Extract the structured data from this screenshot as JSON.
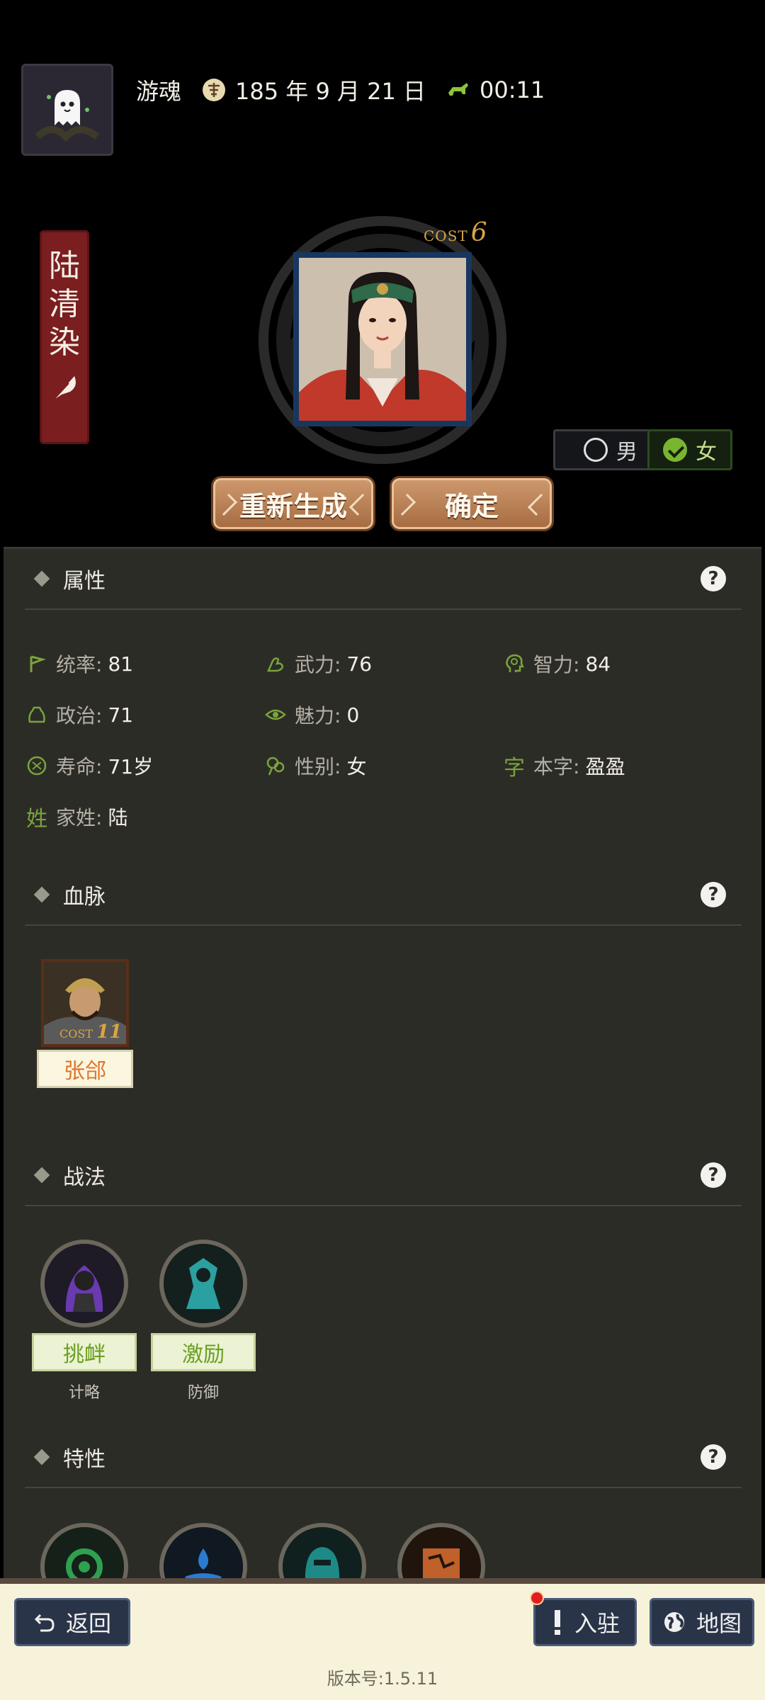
{
  "header": {
    "player_name": "游魂",
    "date": "185 年 9 月 21 日",
    "time": "00:11",
    "avatar_icon": "ghost-avatar-icon",
    "calendar_icon": "calendar-seal-icon",
    "time_icon": "horse-icon"
  },
  "character": {
    "name_chars": [
      "陆",
      "清",
      "染"
    ],
    "cost_label": "COST",
    "cost_value": "6",
    "gender_male": "男",
    "gender_female": "女",
    "selected_gender": "女"
  },
  "actions": {
    "regenerate": "重新生成",
    "confirm": "确定"
  },
  "attributes": {
    "title": "属性",
    "help": "?",
    "items": [
      {
        "key": "统率:",
        "value": "81",
        "icon": "flag-icon"
      },
      {
        "key": "武力:",
        "value": "76",
        "icon": "arm-icon"
      },
      {
        "key": "智力:",
        "value": "84",
        "icon": "brain-icon"
      },
      {
        "key": "政治:",
        "value": "71",
        "icon": "bag-icon"
      },
      {
        "key": "魅力:",
        "value": "0",
        "icon": "eye-icon"
      },
      {
        "key": "寿命:",
        "value": "71岁",
        "icon": "lifespan-icon"
      },
      {
        "key": "性别:",
        "value": "女",
        "icon": "gender-icon"
      },
      {
        "key": "本字:",
        "value": "盈盈",
        "icon_text": "字"
      },
      {
        "key": "家姓:",
        "value": "陆",
        "icon_text": "姓"
      }
    ]
  },
  "lineage": {
    "title": "血脉",
    "help": "?",
    "members": [
      {
        "name": "张郃",
        "cost_label": "COST",
        "cost": "11"
      }
    ]
  },
  "tactics": {
    "title": "战法",
    "help": "?",
    "items": [
      {
        "name": "挑衅",
        "type": "计略",
        "icon": "provoke-icon"
      },
      {
        "name": "激励",
        "type": "防御",
        "icon": "inspire-icon"
      }
    ]
  },
  "traits": {
    "title": "特性",
    "help": "?",
    "icons": [
      "gear-flower-icon",
      "water-hand-icon",
      "hooded-figure-icon",
      "map-scroll-icon"
    ]
  },
  "bottom_nav": {
    "back": "返回",
    "station": "入驻",
    "map": "地图",
    "version": "版本号:1.5.11"
  },
  "colors": {
    "panel_bg": "#2c2c27",
    "accent_green": "#7aa43c",
    "button_brown": "#b87a4e",
    "banner_red": "#7a1e20",
    "nav_blue": "#2a3448"
  }
}
